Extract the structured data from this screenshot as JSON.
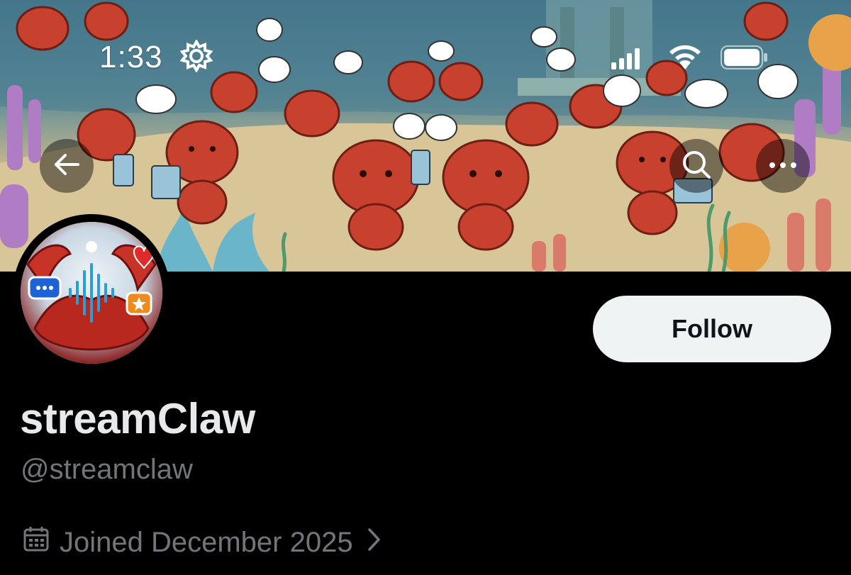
{
  "status_bar": {
    "time": "1:33"
  },
  "nav": {
    "back_icon": "arrow-left-icon",
    "search_icon": "search-icon",
    "more_icon": "more-horizontal-icon"
  },
  "profile": {
    "display_name": "streamClaw",
    "handle": "@streamclaw",
    "joined": "Joined December 2025",
    "follow_label": "Follow"
  },
  "colors": {
    "background": "#000000",
    "follow_button_bg": "#eff3f4",
    "name_text": "#e7e9ea",
    "secondary_text": "#71767b",
    "lobster_red": "#c8412e"
  }
}
